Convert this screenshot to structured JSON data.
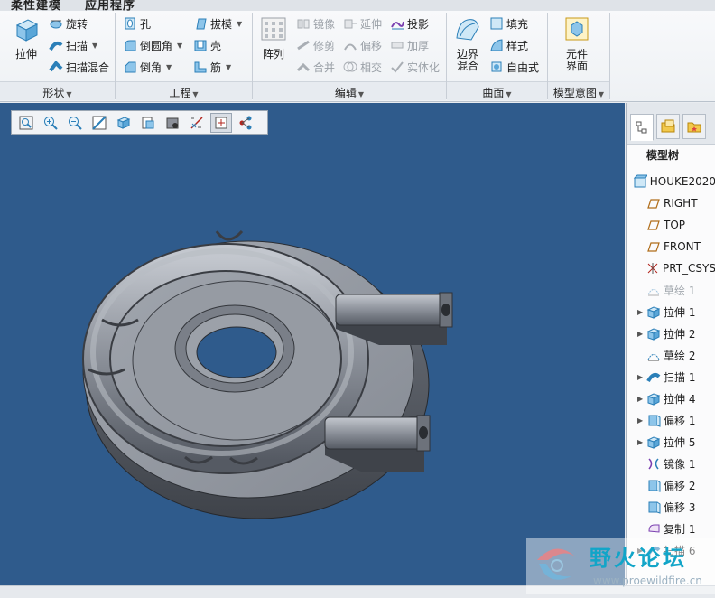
{
  "tabs": [
    "柔性建模",
    "应用程序"
  ],
  "groups": {
    "shape": {
      "label": "形状"
    },
    "engineering": {
      "label": "工程"
    },
    "edit": {
      "label": "编辑"
    },
    "surface": {
      "label": "曲面"
    },
    "intent": {
      "label": "模型意图"
    }
  },
  "shape": {
    "extrude": "拉伸",
    "revolve": "旋转",
    "sweep": "扫描",
    "swept_blend": "扫描混合"
  },
  "engineering": {
    "hole": "孔",
    "round": "倒圆角",
    "chamfer": "倒角",
    "draft": "拔模",
    "shell": "壳",
    "rib": "筋"
  },
  "edit": {
    "pattern": "阵列",
    "mirror": "镜像",
    "trim": "修剪",
    "merge": "合并",
    "extend": "延伸",
    "offset": "偏移",
    "intersect": "相交",
    "project": "投影",
    "thicken": "加厚",
    "solidify": "实体化"
  },
  "surface": {
    "boundary_blend": "边界混合",
    "fill": "填充",
    "style": "样式",
    "freestyle": "自由式"
  },
  "intent": {
    "component_interface": "元件界面"
  },
  "tree": {
    "title": "模型树",
    "items": [
      {
        "label": "HOUKE2020",
        "icon": "part-icon",
        "expand": false
      },
      {
        "label": "RIGHT",
        "icon": "datum-plane-icon",
        "expand": false
      },
      {
        "label": "TOP",
        "icon": "datum-plane-icon",
        "expand": false
      },
      {
        "label": "FRONT",
        "icon": "datum-plane-icon",
        "expand": false
      },
      {
        "label": "PRT_CSYS",
        "icon": "csys-icon",
        "expand": false
      },
      {
        "label": "草绘 1",
        "icon": "sketch-icon",
        "expand": false,
        "suppressed": true
      },
      {
        "label": "拉伸 1",
        "icon": "extrude-icon",
        "expand": true
      },
      {
        "label": "拉伸 2",
        "icon": "extrude-icon",
        "expand": true
      },
      {
        "label": "草绘 2",
        "icon": "sketch-icon",
        "expand": false
      },
      {
        "label": "扫描 1",
        "icon": "sweep-icon",
        "expand": true
      },
      {
        "label": "拉伸 4",
        "icon": "extrude-icon",
        "expand": true
      },
      {
        "label": "偏移 1",
        "icon": "offset-icon",
        "expand": true
      },
      {
        "label": "拉伸 5",
        "icon": "extrude-icon",
        "expand": true
      },
      {
        "label": "镜像 1",
        "icon": "mirror-icon",
        "expand": false
      },
      {
        "label": "偏移 2",
        "icon": "offset-icon",
        "expand": false
      },
      {
        "label": "偏移 3",
        "icon": "offset-icon",
        "expand": false
      },
      {
        "label": "复制 1",
        "icon": "copy-icon",
        "expand": false
      },
      {
        "label": "扫描 6",
        "icon": "sweep-icon",
        "expand": true
      }
    ]
  },
  "watermark": {
    "title": "野火论坛",
    "url": "www.proewildfire.cn"
  },
  "colors": {
    "viewport": "#2f5b8c",
    "model": "#8c9099"
  }
}
